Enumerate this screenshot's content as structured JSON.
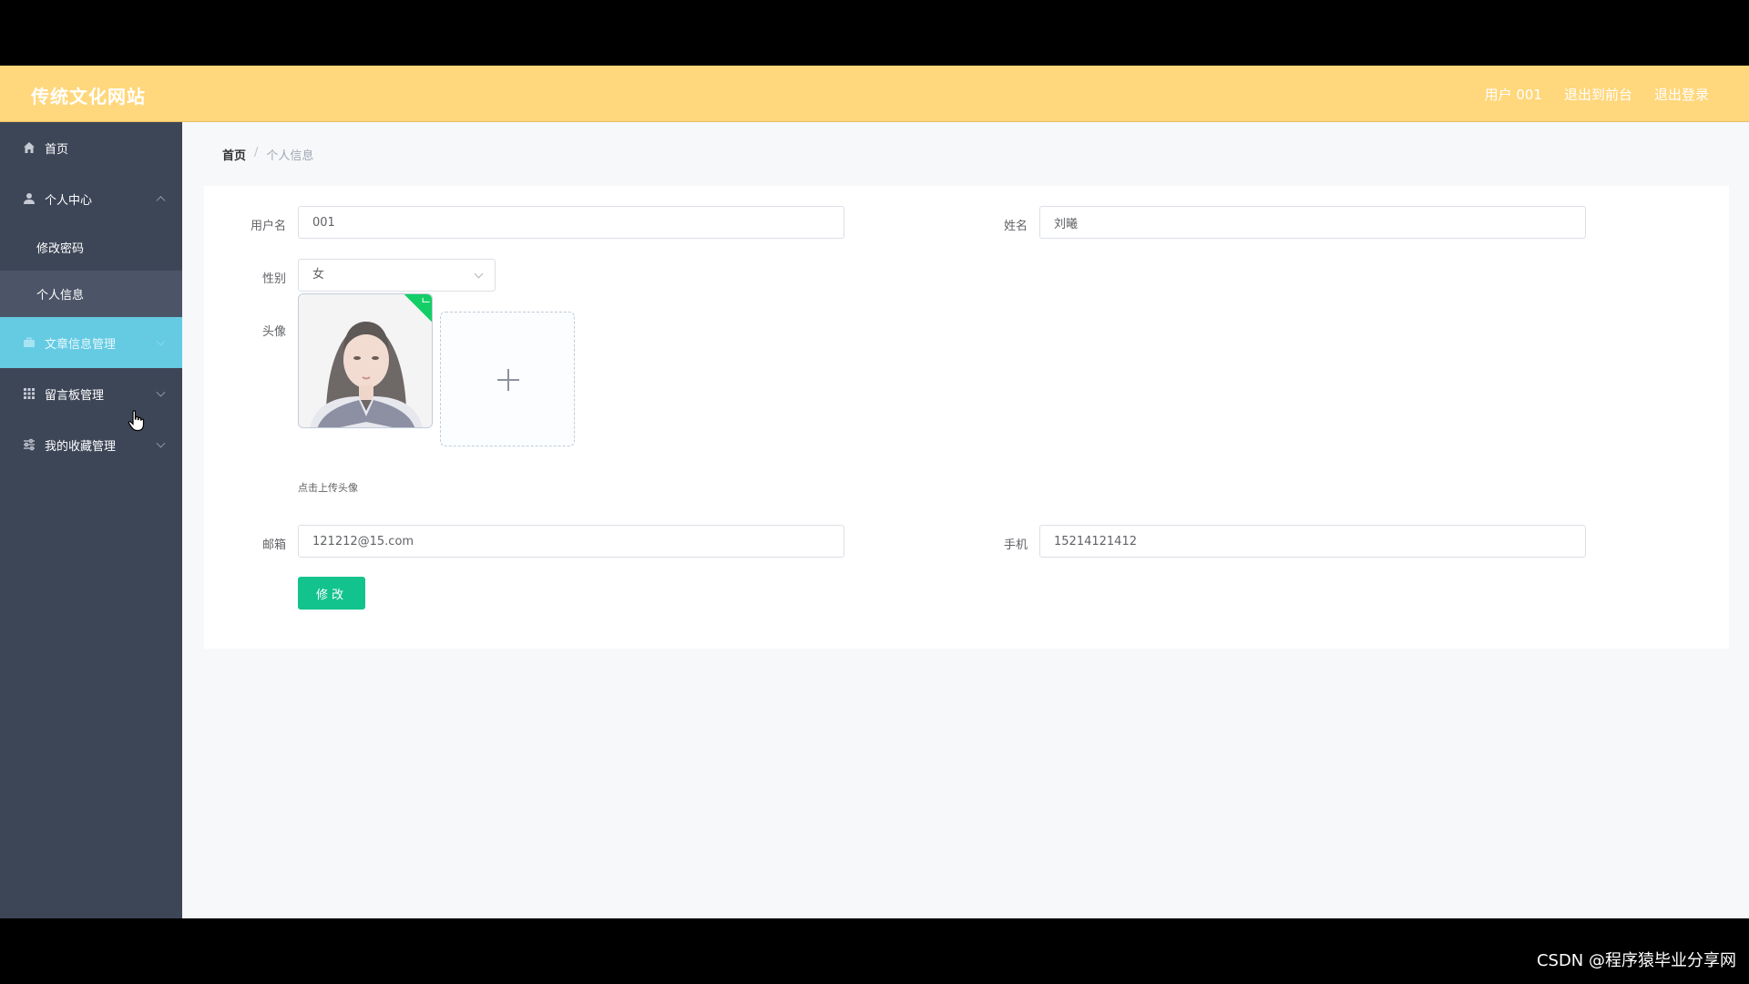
{
  "header": {
    "logo": "传统文化网站",
    "user_label": "用户 001",
    "to_front": "退出到前台",
    "logout": "退出登录",
    "bg_color": "#ffd77c"
  },
  "sidebar": {
    "items": [
      {
        "label": "首页",
        "icon": "home-icon"
      },
      {
        "label": "个人中心",
        "icon": "user-icon",
        "expanded": true,
        "children": [
          {
            "label": "修改密码"
          },
          {
            "label": "个人信息",
            "selected": true
          }
        ]
      },
      {
        "label": "文章信息管理",
        "icon": "briefcase-icon",
        "active": true
      },
      {
        "label": "留言板管理",
        "icon": "grid-icon"
      },
      {
        "label": "我的收藏管理",
        "icon": "sliders-icon"
      }
    ],
    "active_color": "#64cbe3",
    "bg_color": "#3d4657"
  },
  "breadcrumb": {
    "home": "首页",
    "separator": "/",
    "current": "个人信息"
  },
  "form": {
    "username_label": "用户名",
    "username_value": "001",
    "name_label": "姓名",
    "name_value": "刘曦",
    "gender_label": "性别",
    "gender_value": "女",
    "avatar_label": "头像",
    "upload_tip": "点击上传头像",
    "email_label": "邮箱",
    "email_value": "121212@15.com",
    "phone_label": "手机",
    "phone_value": "15214121412",
    "submit_label": "修改",
    "submit_color": "#13c38d"
  },
  "watermark": "CSDN @程序猿毕业分享网"
}
